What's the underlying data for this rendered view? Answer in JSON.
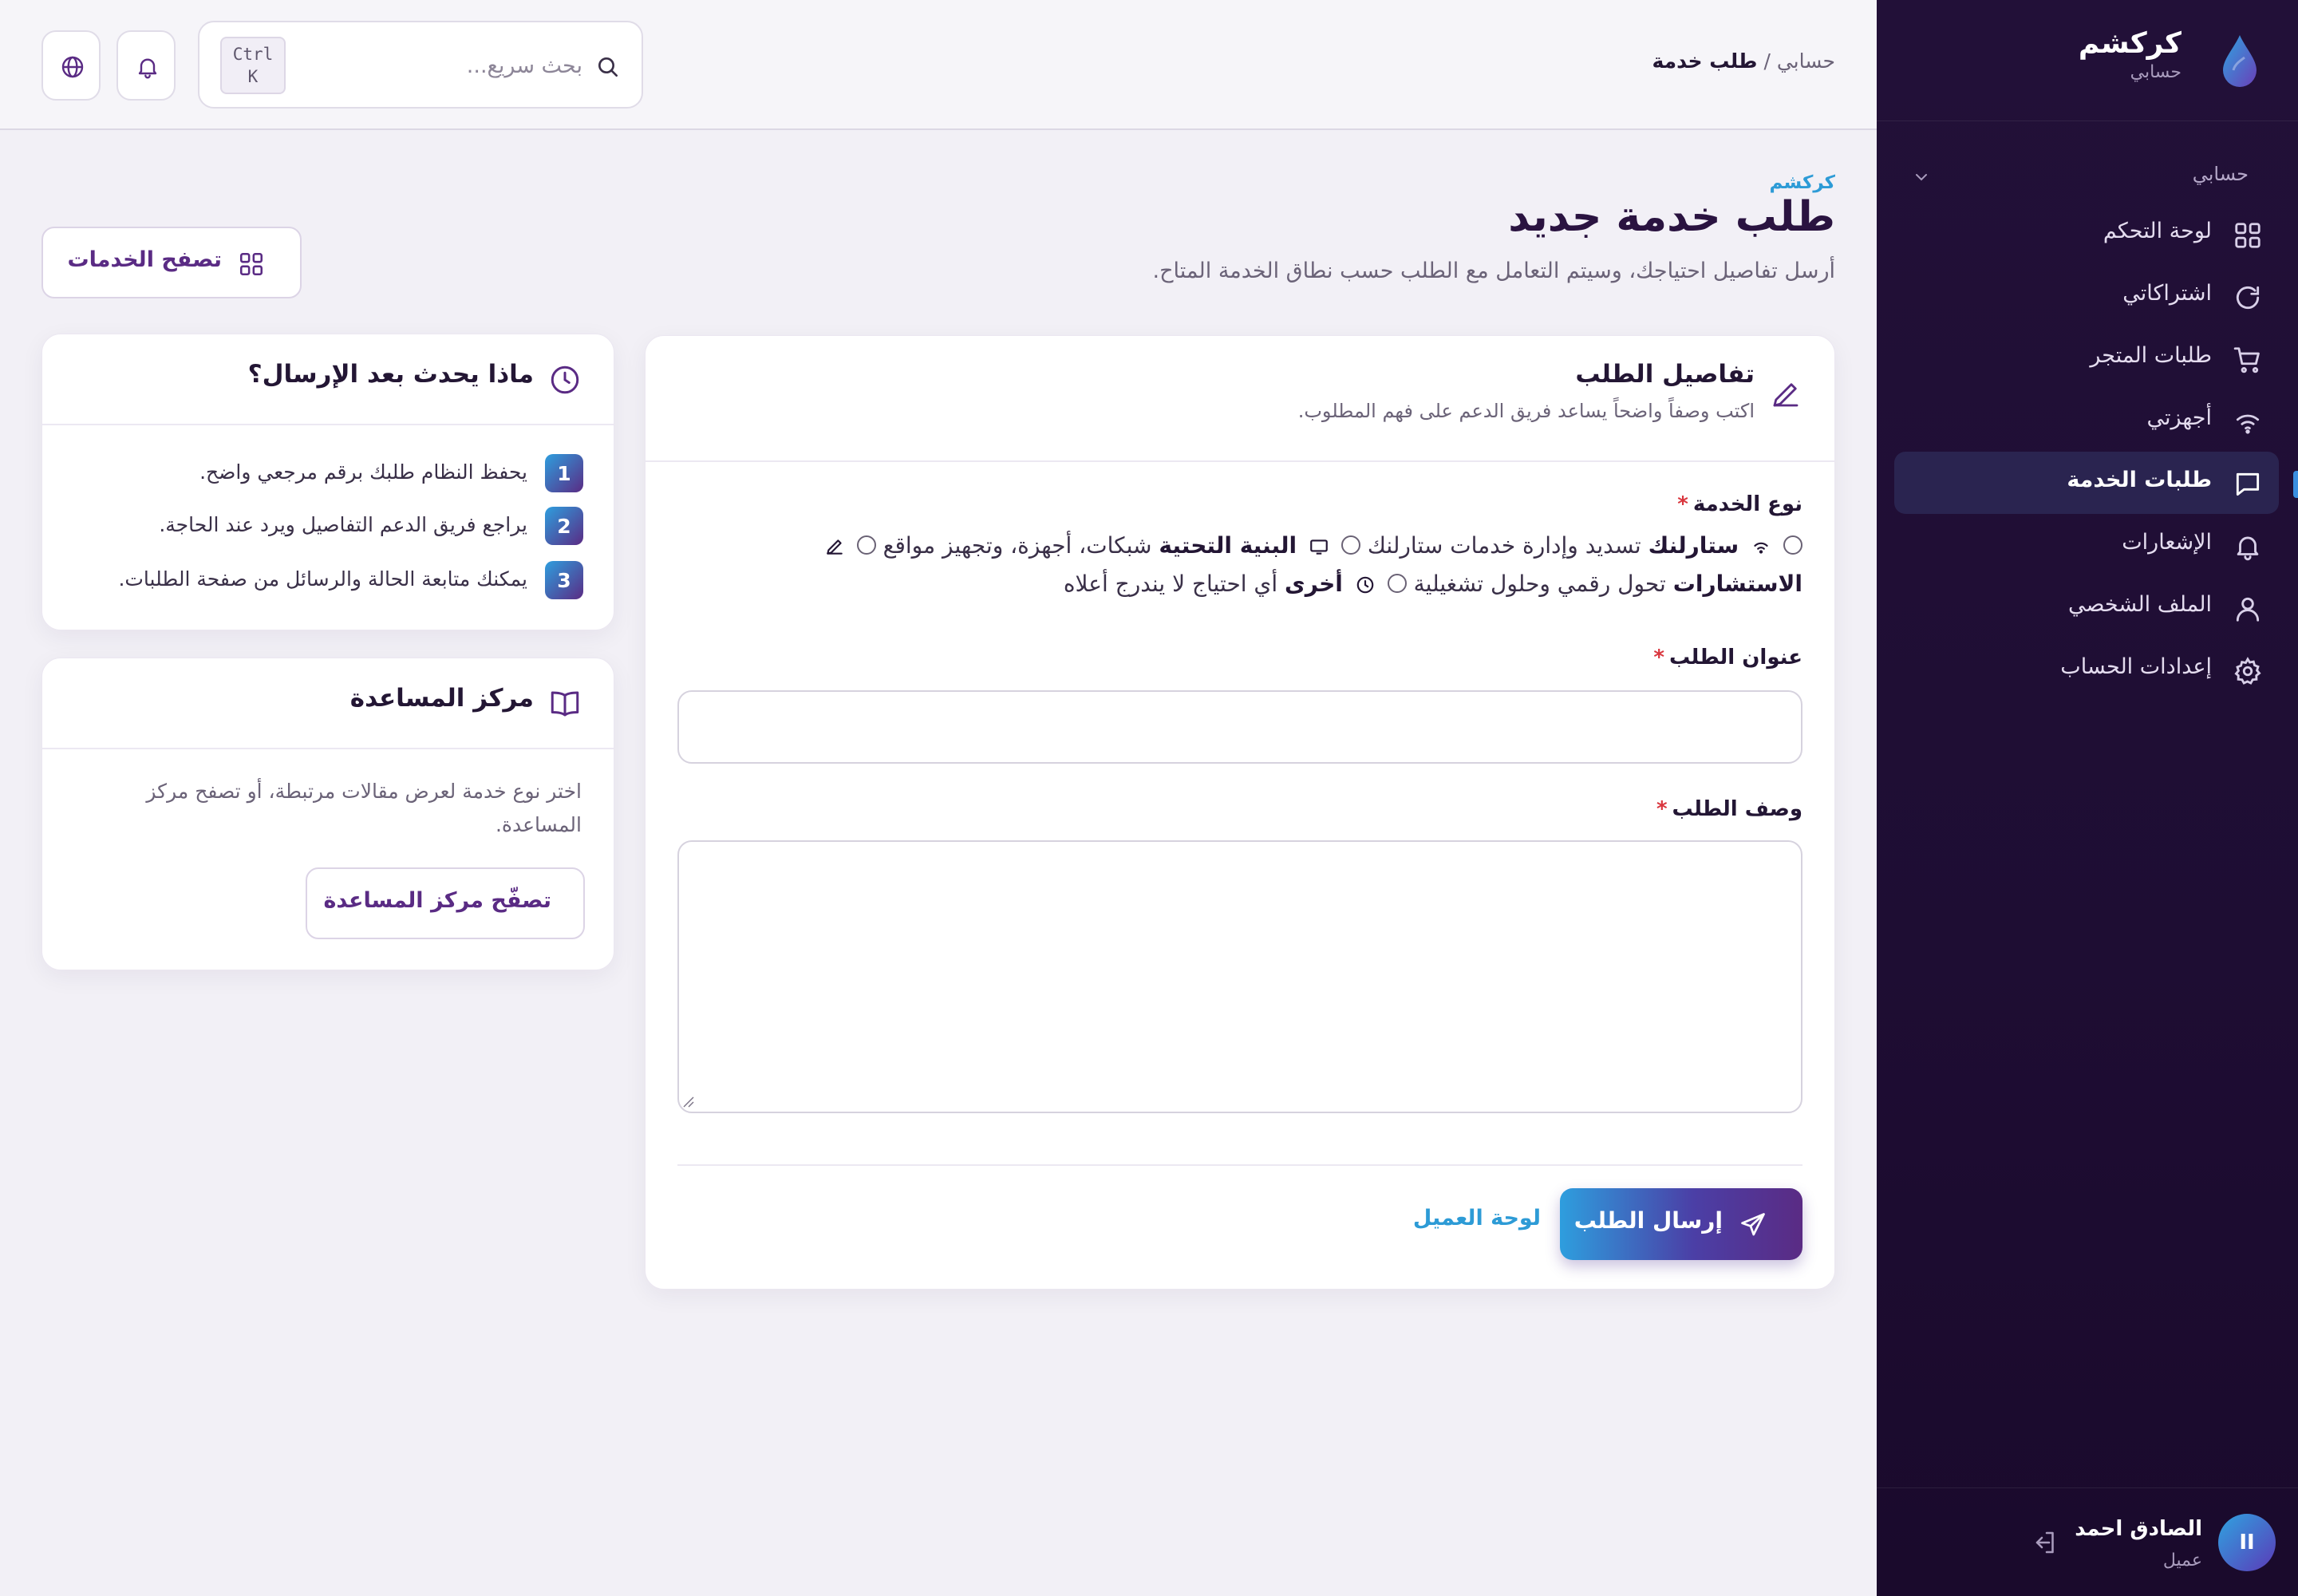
{
  "brand": {
    "name": "كركشم",
    "subtitle": "حسابي"
  },
  "sidebar": {
    "group_label": "حسابي",
    "items": [
      {
        "label": "لوحة التحكم",
        "icon": "grid-icon"
      },
      {
        "label": "اشتراكاتي",
        "icon": "refresh-icon"
      },
      {
        "label": "طلبات المتجر",
        "icon": "cart-icon"
      },
      {
        "label": "أجهزتي",
        "icon": "wifi-icon"
      },
      {
        "label": "طلبات الخدمة",
        "icon": "message-icon",
        "active": true
      },
      {
        "label": "الإشعارات",
        "icon": "bell-icon"
      },
      {
        "label": "الملف الشخصي",
        "icon": "user-icon"
      },
      {
        "label": "إعدادات الحساب",
        "icon": "gear-icon"
      }
    ]
  },
  "user": {
    "initials": "II",
    "name": "الصادق احمد",
    "role": "عميل"
  },
  "header": {
    "breadcrumb_root": "حسابي",
    "breadcrumb_separator": "/",
    "breadcrumb_current": "طلب خدمة",
    "search_placeholder": "بحث سريع...",
    "shortcut_line1": "Ctrl",
    "shortcut_line2": "K"
  },
  "page": {
    "eyebrow": "كركشم",
    "title": "طلب خدمة جديد",
    "subtitle": "أرسل تفاصيل احتياجك، وسيتم التعامل مع الطلب حسب نطاق الخدمة المتاح.",
    "browse_button": "تصفح الخدمات"
  },
  "form": {
    "title": "تفاصيل الطلب",
    "subtitle": "اكتب وصفاً واضحاً يساعد فريق الدعم على فهم المطلوب.",
    "service_type_label": "نوع الخدمة",
    "required_mark": "*",
    "options": [
      {
        "name": "ستارلنك",
        "desc": "تسديد وإدارة خدمات ستارلنك",
        "icon": "wifi-icon"
      },
      {
        "name": "البنية التحتية",
        "desc": "شبكات، أجهزة، وتجهيز مواقع",
        "icon": "monitor-icon"
      },
      {
        "name": "",
        "desc": "",
        "icon": "pencil-icon"
      },
      {
        "name": "الاستشارات",
        "desc": "تحول رقمي وحلول تشغيلية",
        "icon": ""
      },
      {
        "name": "أخرى",
        "desc": "أي احتياج لا يندرج أعلاه",
        "icon": "clock-icon"
      }
    ],
    "title_label": "عنوان الطلب",
    "title_value": "",
    "description_label": "وصف الطلب",
    "description_value": "",
    "submit_label": "إرسال الطلب",
    "dashboard_link": "لوحة العميل"
  },
  "steps_card": {
    "title": "ماذا يحدث بعد الإرسال؟",
    "steps": [
      {
        "num": "1",
        "text": "يحفظ النظام طلبك برقم مرجعي واضح."
      },
      {
        "num": "2",
        "text": "يراجع فريق الدعم التفاصيل ويرد عند الحاجة."
      },
      {
        "num": "3",
        "text": "يمكنك متابعة الحالة والرسائل من صفحة الطلبات."
      }
    ]
  },
  "help_card": {
    "title": "مركز المساعدة",
    "text": "اختر نوع خدمة لعرض مقالات مرتبطة، أو تصفح مركز المساعدة.",
    "button": "تصفّح مركز المساعدة"
  },
  "colors": {
    "sidebar_bg": "#221038",
    "accent_blue": "#2d9bd6",
    "accent_purple": "#5a2b84",
    "required_red": "#d9363e"
  }
}
